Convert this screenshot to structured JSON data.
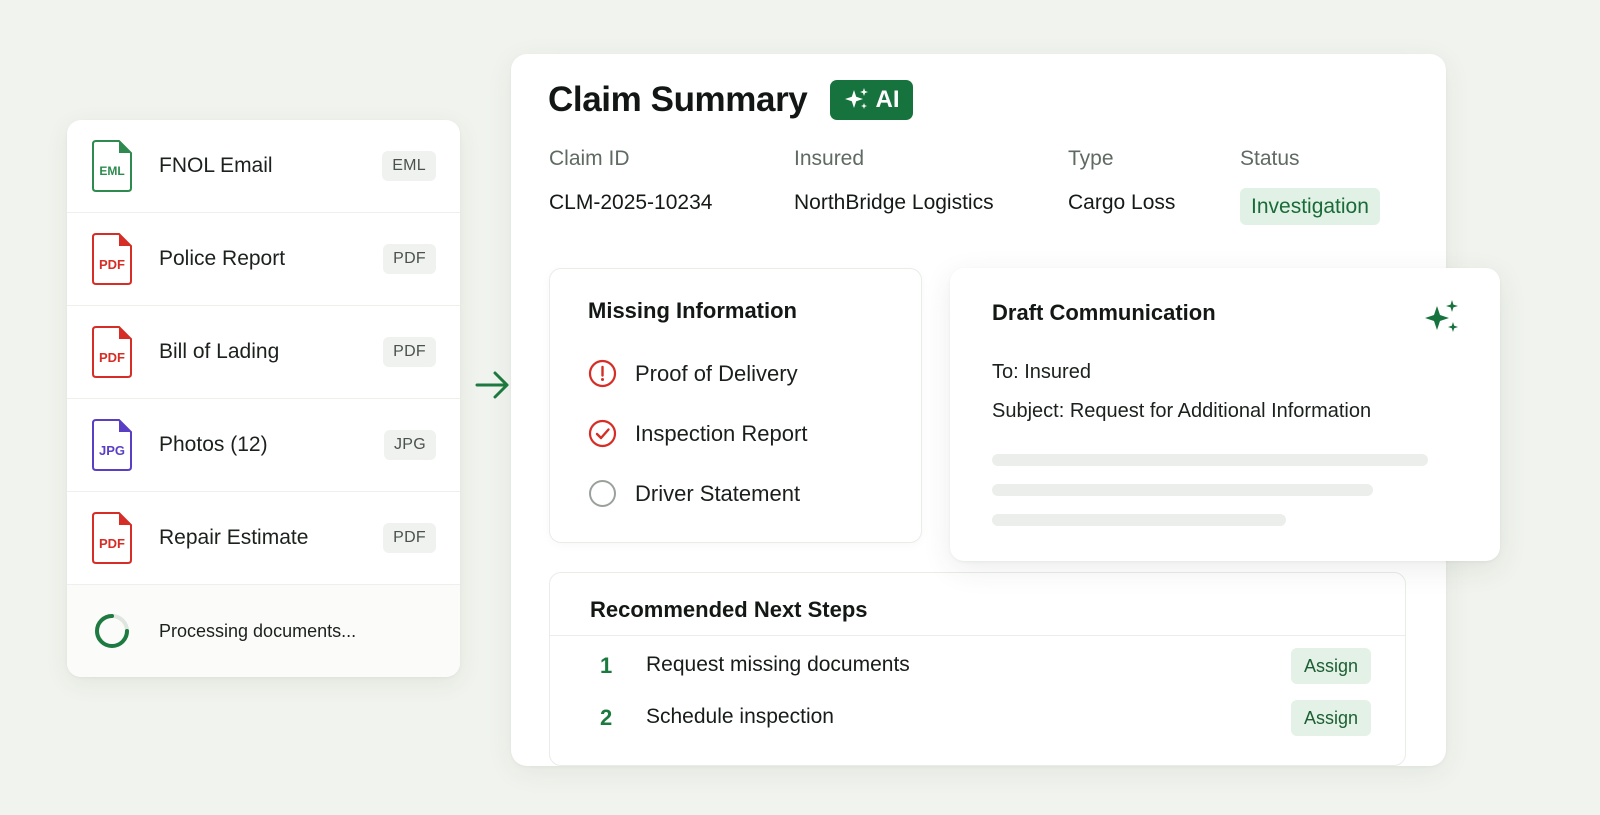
{
  "documents": [
    {
      "name": "FNOL Email",
      "badge": "EML",
      "icon_text": "EML",
      "icon": "eml-file-icon",
      "color": "#2e8a4f"
    },
    {
      "name": "Police Report",
      "badge": "PDF",
      "icon_text": "PDF",
      "icon": "pdf-file-icon",
      "color": "#d62d26"
    },
    {
      "name": "Bill of Lading",
      "badge": "PDF",
      "icon_text": "PDF",
      "icon": "pdf-file-icon",
      "color": "#d62d26"
    },
    {
      "name": "Photos (12)",
      "badge": "JPG",
      "icon_text": "JPG",
      "icon": "jpg-file-icon",
      "color": "#5a3fc4"
    },
    {
      "name": "Repair Estimate",
      "badge": "PDF",
      "icon_text": "PDF",
      "icon": "pdf-file-icon",
      "color": "#d62d26"
    }
  ],
  "processing": {
    "text": "Processing documents..."
  },
  "claim": {
    "title": "Claim Summary",
    "ai_badge": "AI",
    "labels": {
      "claim_id": "Claim ID",
      "insured": "Insured",
      "type": "Type",
      "status": "Status"
    },
    "values": {
      "claim_id": "CLM-2025-10234",
      "insured": "NorthBridge Logistics",
      "type": "Cargo Loss",
      "status": "Investigation"
    }
  },
  "missing_info": {
    "title": "Missing Information",
    "items": [
      {
        "label": "Proof of Delivery",
        "state": "alert",
        "icon": "exclamation-circle-icon"
      },
      {
        "label": "Inspection Report",
        "state": "checked",
        "icon": "check-circle-icon"
      },
      {
        "label": "Driver Statement",
        "state": "empty",
        "icon": "empty-circle-icon"
      }
    ]
  },
  "draft": {
    "title": "Draft Communication",
    "to": "To: Insured",
    "subject": "Subject: Request for Additional Information"
  },
  "next_steps": {
    "title": "Recommended Next Steps",
    "steps": [
      {
        "num": "1",
        "text": "Request missing documents",
        "action": "Assign"
      },
      {
        "num": "2",
        "text": "Schedule inspection",
        "action": "Assign"
      }
    ]
  },
  "colors": {
    "accent": "#17733d",
    "alert": "#d62d26",
    "background": "#f1f4ee"
  }
}
